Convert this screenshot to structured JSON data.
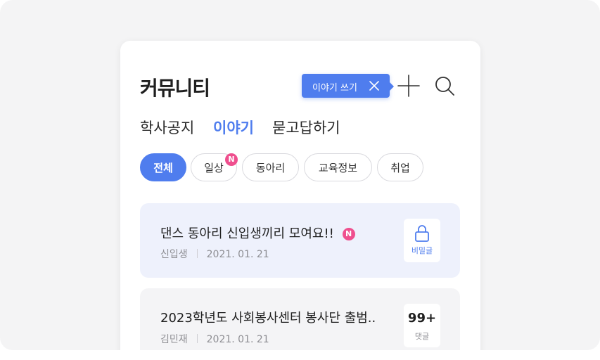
{
  "header": {
    "title": "커뮤니티"
  },
  "tooltip": {
    "text": "이야기 쓰기"
  },
  "tabs": [
    {
      "label": "학사공지",
      "active": false
    },
    {
      "label": "이야기",
      "active": true
    },
    {
      "label": "묻고답하기",
      "active": false
    }
  ],
  "chips": [
    {
      "label": "전체",
      "active": true,
      "badge": ""
    },
    {
      "label": "일상",
      "active": false,
      "badge": "N"
    },
    {
      "label": "동아리",
      "active": false,
      "badge": ""
    },
    {
      "label": "교육정보",
      "active": false,
      "badge": ""
    },
    {
      "label": "취업",
      "active": false,
      "badge": ""
    }
  ],
  "posts": [
    {
      "title": "댄스 동아리 신입생끼리 모여요!!",
      "badge": "N",
      "author": "신입생",
      "date": "2021. 01. 21",
      "side_label": "비밀글",
      "side_icon": "lock-icon"
    },
    {
      "title": "2023학년도 사회봉사센터 봉사단 출범..",
      "author": "김민재",
      "date": "2021. 01. 21",
      "comment_count": "99+",
      "comment_label": "댓글"
    }
  ],
  "colors": {
    "accent": "#4f7dee",
    "badge": "#ef4f8e",
    "highlight_bg": "#eef1fc",
    "card_bg": "#f4f4f6"
  }
}
